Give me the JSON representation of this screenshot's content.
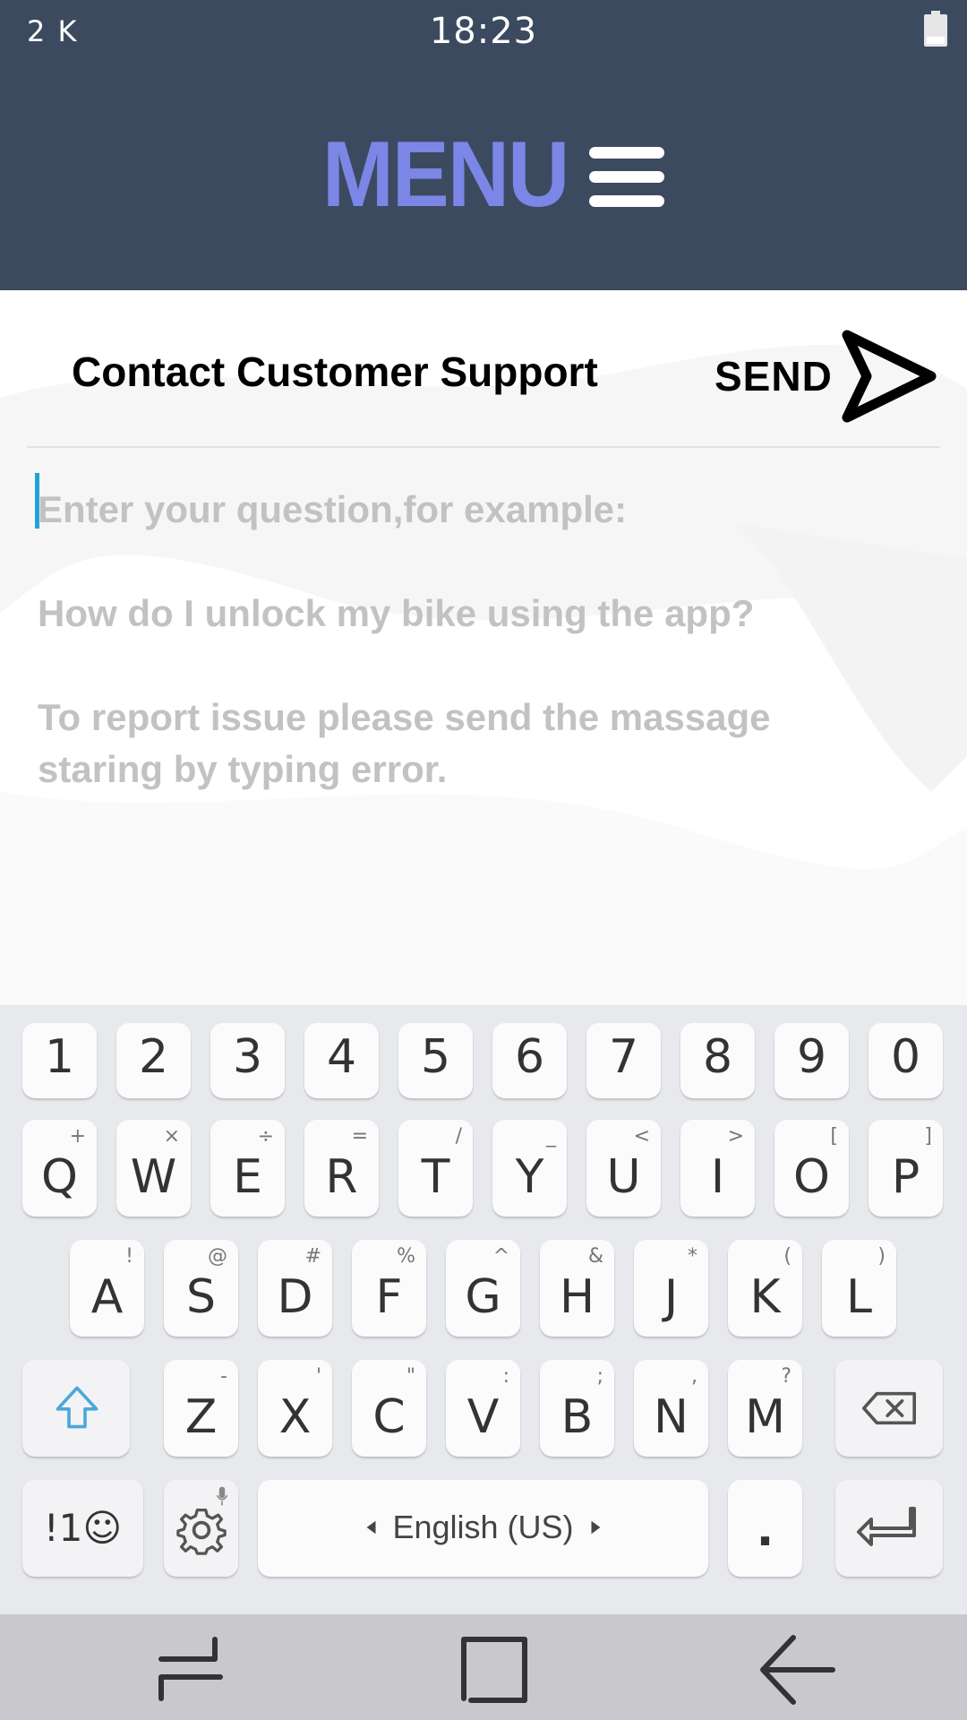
{
  "status_bar": {
    "left_text": "2 K",
    "time": "18:23"
  },
  "header": {
    "menu_label": "MENU"
  },
  "support": {
    "title": "Contact Customer Support",
    "send_label": "SEND",
    "placeholder": "Enter your question,for example:\n\nHow do I unlock my bike using the app?\n\nTo report issue please send the massage\nstaring by typing error."
  },
  "keyboard": {
    "numbers": [
      "1",
      "2",
      "3",
      "4",
      "5",
      "6",
      "7",
      "8",
      "9",
      "0"
    ],
    "row1": [
      {
        "key": "Q",
        "sub": "+"
      },
      {
        "key": "W",
        "sub": "×"
      },
      {
        "key": "E",
        "sub": "÷"
      },
      {
        "key": "R",
        "sub": "="
      },
      {
        "key": "T",
        "sub": "/"
      },
      {
        "key": "Y",
        "sub": "_"
      },
      {
        "key": "U",
        "sub": "<"
      },
      {
        "key": "I",
        "sub": ">"
      },
      {
        "key": "O",
        "sub": "["
      },
      {
        "key": "P",
        "sub": "]"
      }
    ],
    "row2": [
      {
        "key": "A",
        "sub": "!"
      },
      {
        "key": "S",
        "sub": "@"
      },
      {
        "key": "D",
        "sub": "#"
      },
      {
        "key": "F",
        "sub": "%"
      },
      {
        "key": "G",
        "sub": "^"
      },
      {
        "key": "H",
        "sub": "&"
      },
      {
        "key": "J",
        "sub": "*"
      },
      {
        "key": "K",
        "sub": "("
      },
      {
        "key": "L",
        "sub": ")"
      }
    ],
    "row3": [
      {
        "key": "Z",
        "sub": "-"
      },
      {
        "key": "X",
        "sub": "'"
      },
      {
        "key": "C",
        "sub": "\""
      },
      {
        "key": "V",
        "sub": ":"
      },
      {
        "key": "B",
        "sub": ";"
      },
      {
        "key": "N",
        "sub": ","
      },
      {
        "key": "M",
        "sub": "?"
      }
    ],
    "symbols_label": "!1☺",
    "space_label": "English (US)",
    "period_label": "."
  },
  "icons": {
    "menu": "hamburger-icon",
    "send": "send-arrow-icon",
    "shift": "shift-arrow-icon",
    "backspace": "backspace-icon",
    "settings": "gear-icon",
    "enter": "enter-icon",
    "nav_recent": "recent-apps-icon",
    "nav_home": "home-icon",
    "nav_back": "back-arrow-icon",
    "battery": "battery-icon",
    "mic": "microphone-icon"
  },
  "colors": {
    "header_bg": "#3c4a60",
    "menu_text": "#7c86e6",
    "cursor": "#1ea3d6",
    "placeholder": "#c2c2c2",
    "shift_icon": "#4aa8d8"
  }
}
